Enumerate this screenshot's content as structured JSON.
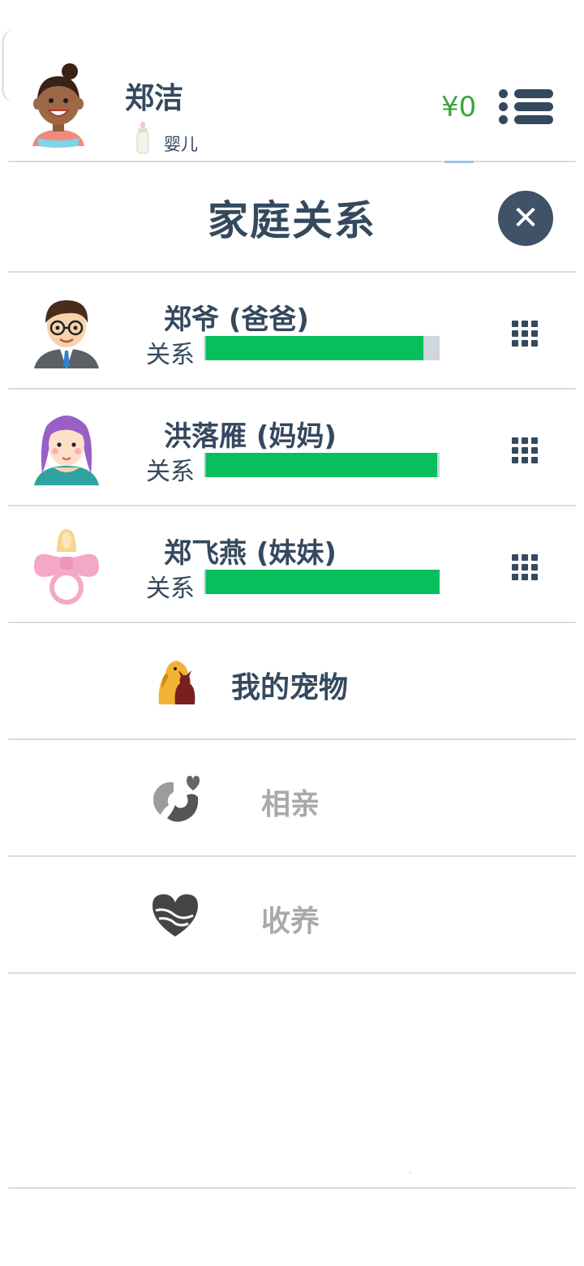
{
  "header": {
    "player_name": "郑洁",
    "life_stage": "婴儿",
    "money": "¥0",
    "avatar_icon": "girl-avatar-icon",
    "stage_icon": "baby-bottle-icon",
    "menu_icon": "list-menu-icon"
  },
  "modal": {
    "title": "家庭关系",
    "close_icon": "close-icon"
  },
  "family": [
    {
      "name": "郑爷 (爸爸)",
      "relation_label": "关系",
      "relation_level": 0.93,
      "icon": "father-avatar-icon"
    },
    {
      "name": "洪落雁 (妈妈)",
      "relation_label": "关系",
      "relation_level": 0.99,
      "icon": "mother-avatar-icon"
    },
    {
      "name": "郑飞燕 (妹妹)",
      "relation_label": "关系",
      "relation_level": 1.0,
      "icon": "pacifier-icon"
    }
  ],
  "actions": [
    {
      "label": "我的宠物",
      "icon": "pet-icon",
      "enabled": true
    },
    {
      "label": "相亲",
      "icon": "couple-icon",
      "enabled": false
    },
    {
      "label": "收养",
      "icon": "heart-hands-icon",
      "enabled": false
    }
  ],
  "colors": {
    "primary_text": "#34495e",
    "money": "#3aa53a",
    "relation_bar": "#07bf5c",
    "relation_track": "#d0d6de",
    "disabled_text": "#a9a9a9"
  }
}
